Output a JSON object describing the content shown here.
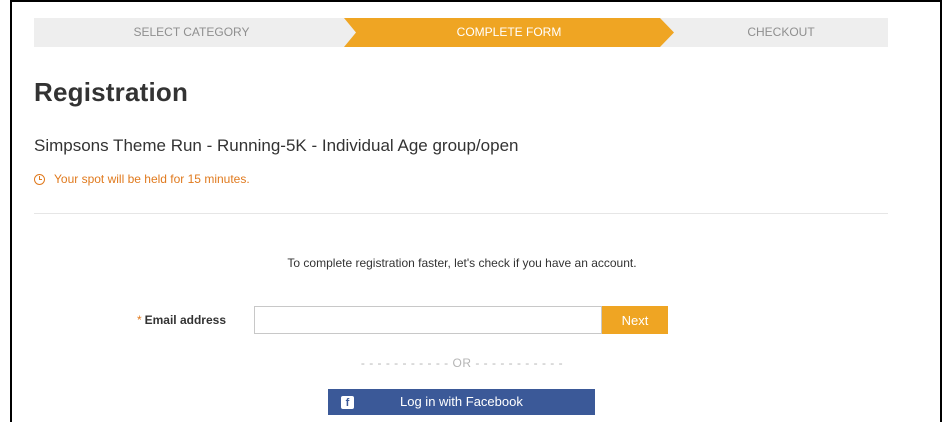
{
  "stepper": {
    "steps": [
      {
        "label": "SELECT CATEGORY",
        "state": "done"
      },
      {
        "label": "COMPLETE FORM",
        "state": "active"
      },
      {
        "label": "CHECKOUT",
        "state": "upcoming"
      }
    ]
  },
  "page": {
    "title": "Registration",
    "event_name": "Simpsons Theme Run - Running-5K - Individual Age group/open",
    "hold_note": "Your spot will be held for 15 minutes."
  },
  "account_check": {
    "message": "To complete registration faster, let's check if you have an account.",
    "email_required_mark": "*",
    "email_label": "Email address",
    "email_value": "",
    "next_label": "Next",
    "or_separator": "- - - - - - - - - - - OR - - - - - - - - - - -",
    "facebook_label": "Log in with Facebook",
    "facebook_icon": "f"
  },
  "colors": {
    "accent": "#efa523",
    "warning_text": "#e07a1e",
    "facebook": "#3b5998",
    "stepper_bg": "#eeeeee"
  }
}
